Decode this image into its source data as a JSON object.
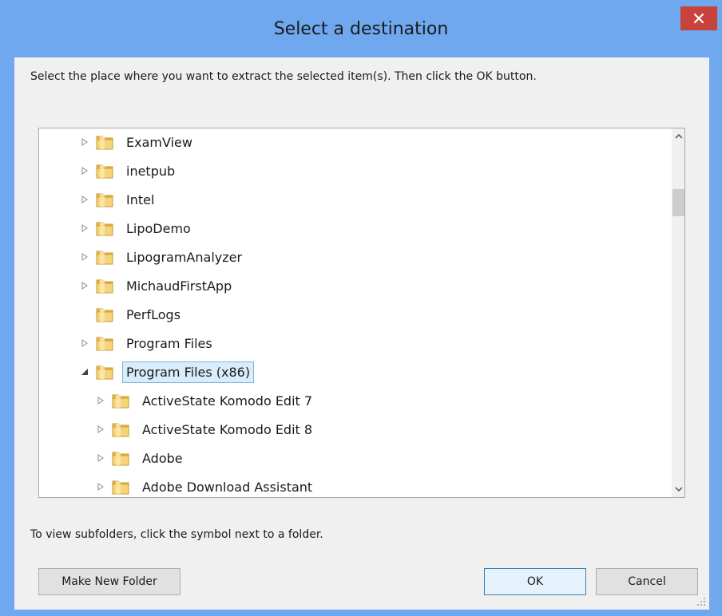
{
  "dialog": {
    "title": "Select a destination",
    "instruction": "Select the place where you want to extract the selected item(s).  Then click the OK button.",
    "hint": "To view subfolders, click the symbol next to a folder."
  },
  "tree": {
    "items": [
      {
        "label": "ExamView",
        "level": 0,
        "expander": "collapsed"
      },
      {
        "label": "inetpub",
        "level": 0,
        "expander": "collapsed"
      },
      {
        "label": "Intel",
        "level": 0,
        "expander": "collapsed"
      },
      {
        "label": "LipoDemo",
        "level": 0,
        "expander": "collapsed"
      },
      {
        "label": "LipogramAnalyzer",
        "level": 0,
        "expander": "collapsed"
      },
      {
        "label": "MichaudFirstApp",
        "level": 0,
        "expander": "collapsed"
      },
      {
        "label": "PerfLogs",
        "level": 0,
        "expander": "none"
      },
      {
        "label": "Program Files",
        "level": 0,
        "expander": "collapsed"
      },
      {
        "label": "Program Files (x86)",
        "level": 0,
        "expander": "expanded",
        "selected": true
      },
      {
        "label": "ActiveState Komodo Edit 7",
        "level": 1,
        "expander": "collapsed"
      },
      {
        "label": "ActiveState Komodo Edit 8",
        "level": 1,
        "expander": "collapsed"
      },
      {
        "label": "Adobe",
        "level": 1,
        "expander": "collapsed"
      },
      {
        "label": "Adobe Download Assistant",
        "level": 1,
        "expander": "collapsed"
      }
    ]
  },
  "buttons": {
    "make_new_folder": "Make New Folder",
    "ok": "OK",
    "cancel": "Cancel"
  },
  "icons": {
    "close": "close-icon",
    "folder": "folder-icon",
    "expand_collapsed": "triangle-right-icon",
    "expand_expanded": "triangle-down-icon",
    "scroll_up": "chevron-up-icon",
    "scroll_down": "chevron-down-icon"
  },
  "colors": {
    "titlebar": "#6fa8ee",
    "close_button": "#c7433b",
    "selection": "#d9ecfb",
    "folder": "#e8b84a"
  }
}
